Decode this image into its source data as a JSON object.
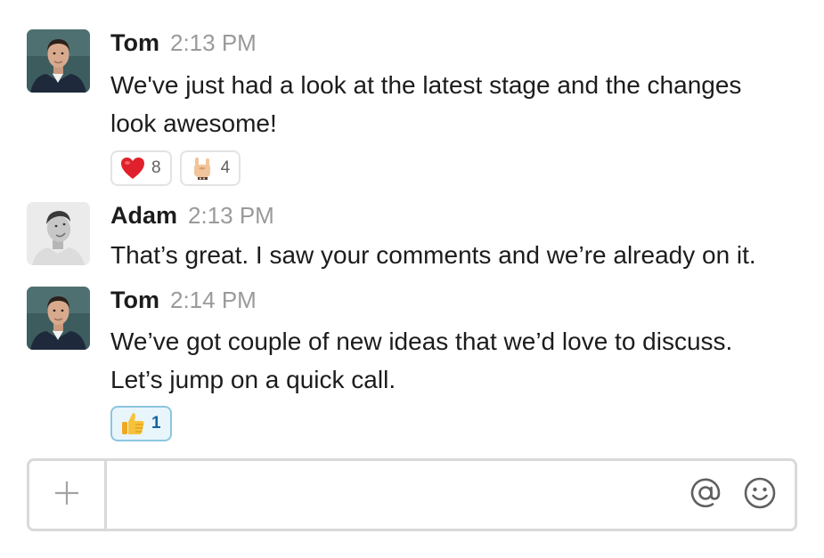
{
  "messages": [
    {
      "author": "Tom",
      "time": "2:13 PM",
      "lines": [
        "We've just had a look at the latest stage and the changes",
        "look awesome!"
      ],
      "reactions": [
        {
          "emoji": "heart-emoji",
          "count": "8"
        },
        {
          "emoji": "rock-on-hand-emoji",
          "count": "4"
        }
      ]
    },
    {
      "author": "Adam",
      "time": "2:13 PM",
      "lines": [
        "That’s great. I saw your comments and we’re already on it."
      ]
    },
    {
      "author": "Tom",
      "time": "2:14 PM",
      "lines": [
        "We’ve got couple of new ideas that we’d love to discuss.",
        "Let’s jump on a quick call."
      ],
      "reactions": [
        {
          "emoji": "thumbs-up-emoji",
          "count": "1",
          "active": true
        }
      ]
    }
  ],
  "composer": {
    "value": "",
    "add_icon": "plus-icon",
    "mention_icon": "at-sign-icon",
    "emoji_icon": "smiley-icon"
  },
  "colors": {
    "author_text": "#1d1c1d",
    "timestamp": "#9a9a9a",
    "reaction_border": "#e3e3e3",
    "active_reaction_bg": "#e8f5fa",
    "active_reaction_border": "#8cc6e0",
    "active_count": "#1264a3",
    "composer_border": "#d9d9d9"
  }
}
